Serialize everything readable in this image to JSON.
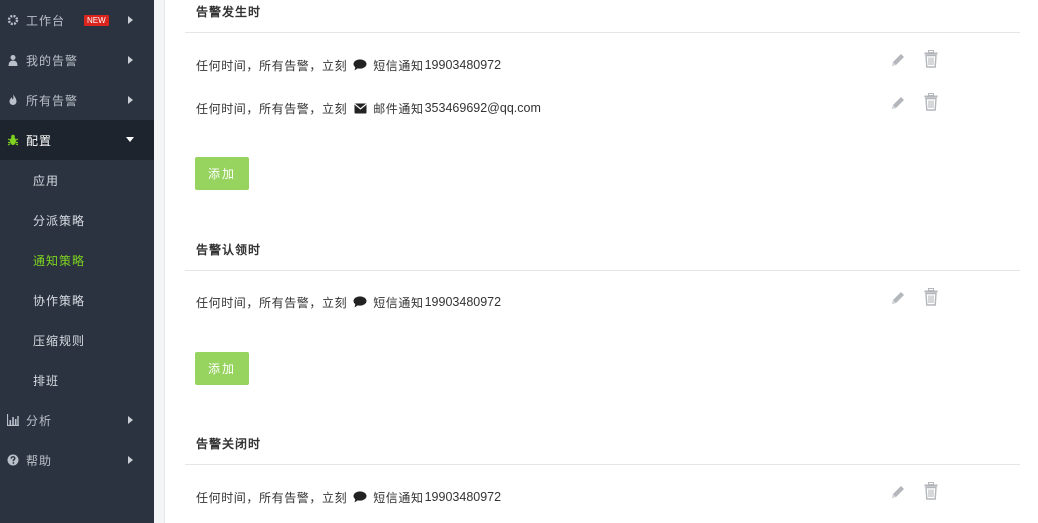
{
  "sidebar": {
    "items": [
      {
        "label": "工作台",
        "badge": "NEW",
        "icon": "gear-icon"
      },
      {
        "label": "我的告警",
        "icon": "user-icon"
      },
      {
        "label": "所有告警",
        "icon": "fire-icon"
      },
      {
        "label": "配置",
        "icon": "bug-icon"
      },
      {
        "label": "分析",
        "icon": "bar-chart-icon"
      },
      {
        "label": "帮助",
        "icon": "question-circle-icon"
      }
    ],
    "config_sub": [
      {
        "label": "应用"
      },
      {
        "label": "分派策略"
      },
      {
        "label": "通知策略"
      },
      {
        "label": "协作策略"
      },
      {
        "label": "压缩规则"
      },
      {
        "label": "排班"
      }
    ]
  },
  "sections": [
    {
      "title": "告警发生时",
      "rules": [
        {
          "condition": "任何时间，所有告警，立刻",
          "channel_icon": "comment-icon",
          "channel": "短信通知",
          "target": "19903480972"
        },
        {
          "condition": "任何时间，所有告警，立刻",
          "channel_icon": "envelope-icon",
          "channel": "邮件通知",
          "target": "353469692@qq.com"
        }
      ],
      "add_label": "添加"
    },
    {
      "title": "告警认领时",
      "rules": [
        {
          "condition": "任何时间，所有告警，立刻",
          "channel_icon": "comment-icon",
          "channel": "短信通知",
          "target": "19903480972"
        }
      ],
      "add_label": "添加"
    },
    {
      "title": "告警关闭时",
      "rules": [
        {
          "condition": "任何时间，所有告警，立刻",
          "channel_icon": "comment-icon",
          "channel": "短信通知",
          "target": "19903480972"
        }
      ]
    }
  ],
  "colors": {
    "sidebar_bg": "#2b3340",
    "sidebar_active_bg": "#1e242d",
    "active_sub_text": "#7ed321",
    "add_button": "#96d35f",
    "new_badge": "#d9251d"
  }
}
